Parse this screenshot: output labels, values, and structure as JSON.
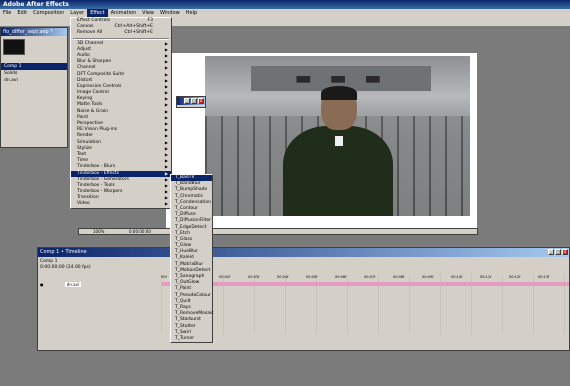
{
  "app_title": "Adobe After Effects",
  "menubar": [
    "File",
    "Edit",
    "Composition",
    "Layer",
    "Effect",
    "Animation",
    "View",
    "Window",
    "Help"
  ],
  "project_panel": {
    "title": "flo_differ_sepr.aep *",
    "items": [
      "Comp 1",
      "Solids",
      "dn.avi"
    ],
    "selected": "Comp 1"
  },
  "effect_menu": {
    "items": [
      {
        "label": "Effect Controls",
        "shortcut": "F3"
      },
      {
        "label": "Canvas",
        "shortcut": "Ctrl+Alt+Shift+E"
      },
      {
        "label": "Remove All",
        "shortcut": "Ctrl+Shift+E"
      },
      {
        "label": "3D Channel",
        "sub": true
      },
      {
        "label": "Adjust",
        "sub": true
      },
      {
        "label": "Audio",
        "sub": true
      },
      {
        "label": "Blur & Sharpen",
        "sub": true
      },
      {
        "label": "Channel",
        "sub": true
      },
      {
        "label": "DFT Composite Suite",
        "sub": true
      },
      {
        "label": "Distort",
        "sub": true
      },
      {
        "label": "Expression Controls",
        "sub": true
      },
      {
        "label": "Image Control",
        "sub": true
      },
      {
        "label": "Keying",
        "sub": true
      },
      {
        "label": "Matte Tools",
        "sub": true
      },
      {
        "label": "Noise & Grain",
        "sub": true
      },
      {
        "label": "Paint",
        "sub": true
      },
      {
        "label": "Perspective",
        "sub": true
      },
      {
        "label": "RE:Vision Plug-ins",
        "sub": true
      },
      {
        "label": "Render",
        "sub": true
      },
      {
        "label": "Simulation",
        "sub": true
      },
      {
        "label": "Stylize",
        "sub": true
      },
      {
        "label": "Text",
        "sub": true
      },
      {
        "label": "Time",
        "sub": true
      },
      {
        "label": "Tinderbox - Blurs",
        "sub": true
      },
      {
        "label": "Tinderbox - Effects",
        "sub": true,
        "highlight": true
      },
      {
        "label": "Tinderbox - Generators",
        "sub": true
      },
      {
        "label": "Tinderbox - Tools",
        "sub": true
      },
      {
        "label": "Tinderbox - Warpers",
        "sub": true
      },
      {
        "label": "Transition",
        "sub": true
      },
      {
        "label": "Video",
        "sub": true
      }
    ]
  },
  "submenu": {
    "items": [
      "T_BadTV",
      "T_BandBlur",
      "T_BumpShade",
      "T_Chromatic",
      "T_Condensation",
      "T_Contour",
      "T_Diffuse",
      "T_DiffusionFilter",
      "T_EdgeDetect",
      "T_Etch",
      "T_Glass",
      "T_Glow",
      "T_HueBlur",
      "T_Kaleid",
      "T_MatrixBlur",
      "T_MotionDetect",
      "T_Sanograph",
      "T_OutGlow",
      "T_Paint",
      "T_PseudoColour",
      "T_Quilt",
      "T_Rays",
      "T_RemoveMosaic",
      "T_Starburst",
      "T_Stutter",
      "T_Swirl",
      "T_Turner"
    ],
    "highlight": "T_BadTV"
  },
  "timeline": {
    "title": "Comp 1 • Timeline",
    "tab": "Comp 1",
    "time": "0:00:00:00",
    "fps": "(24.00 fps)",
    "layer_name": "dn.avi",
    "ticks": [
      "00f",
      "00:01f",
      "00:02f",
      "00:03f",
      "00:04f",
      "00:05f",
      "00:06f",
      "00:07f",
      "00:08f",
      "00:09f",
      "00:10f",
      "00:11f",
      "00:12f",
      "00:13f"
    ]
  },
  "comp_window": {
    "zoom": "100%",
    "time": "0:00:00:00"
  }
}
